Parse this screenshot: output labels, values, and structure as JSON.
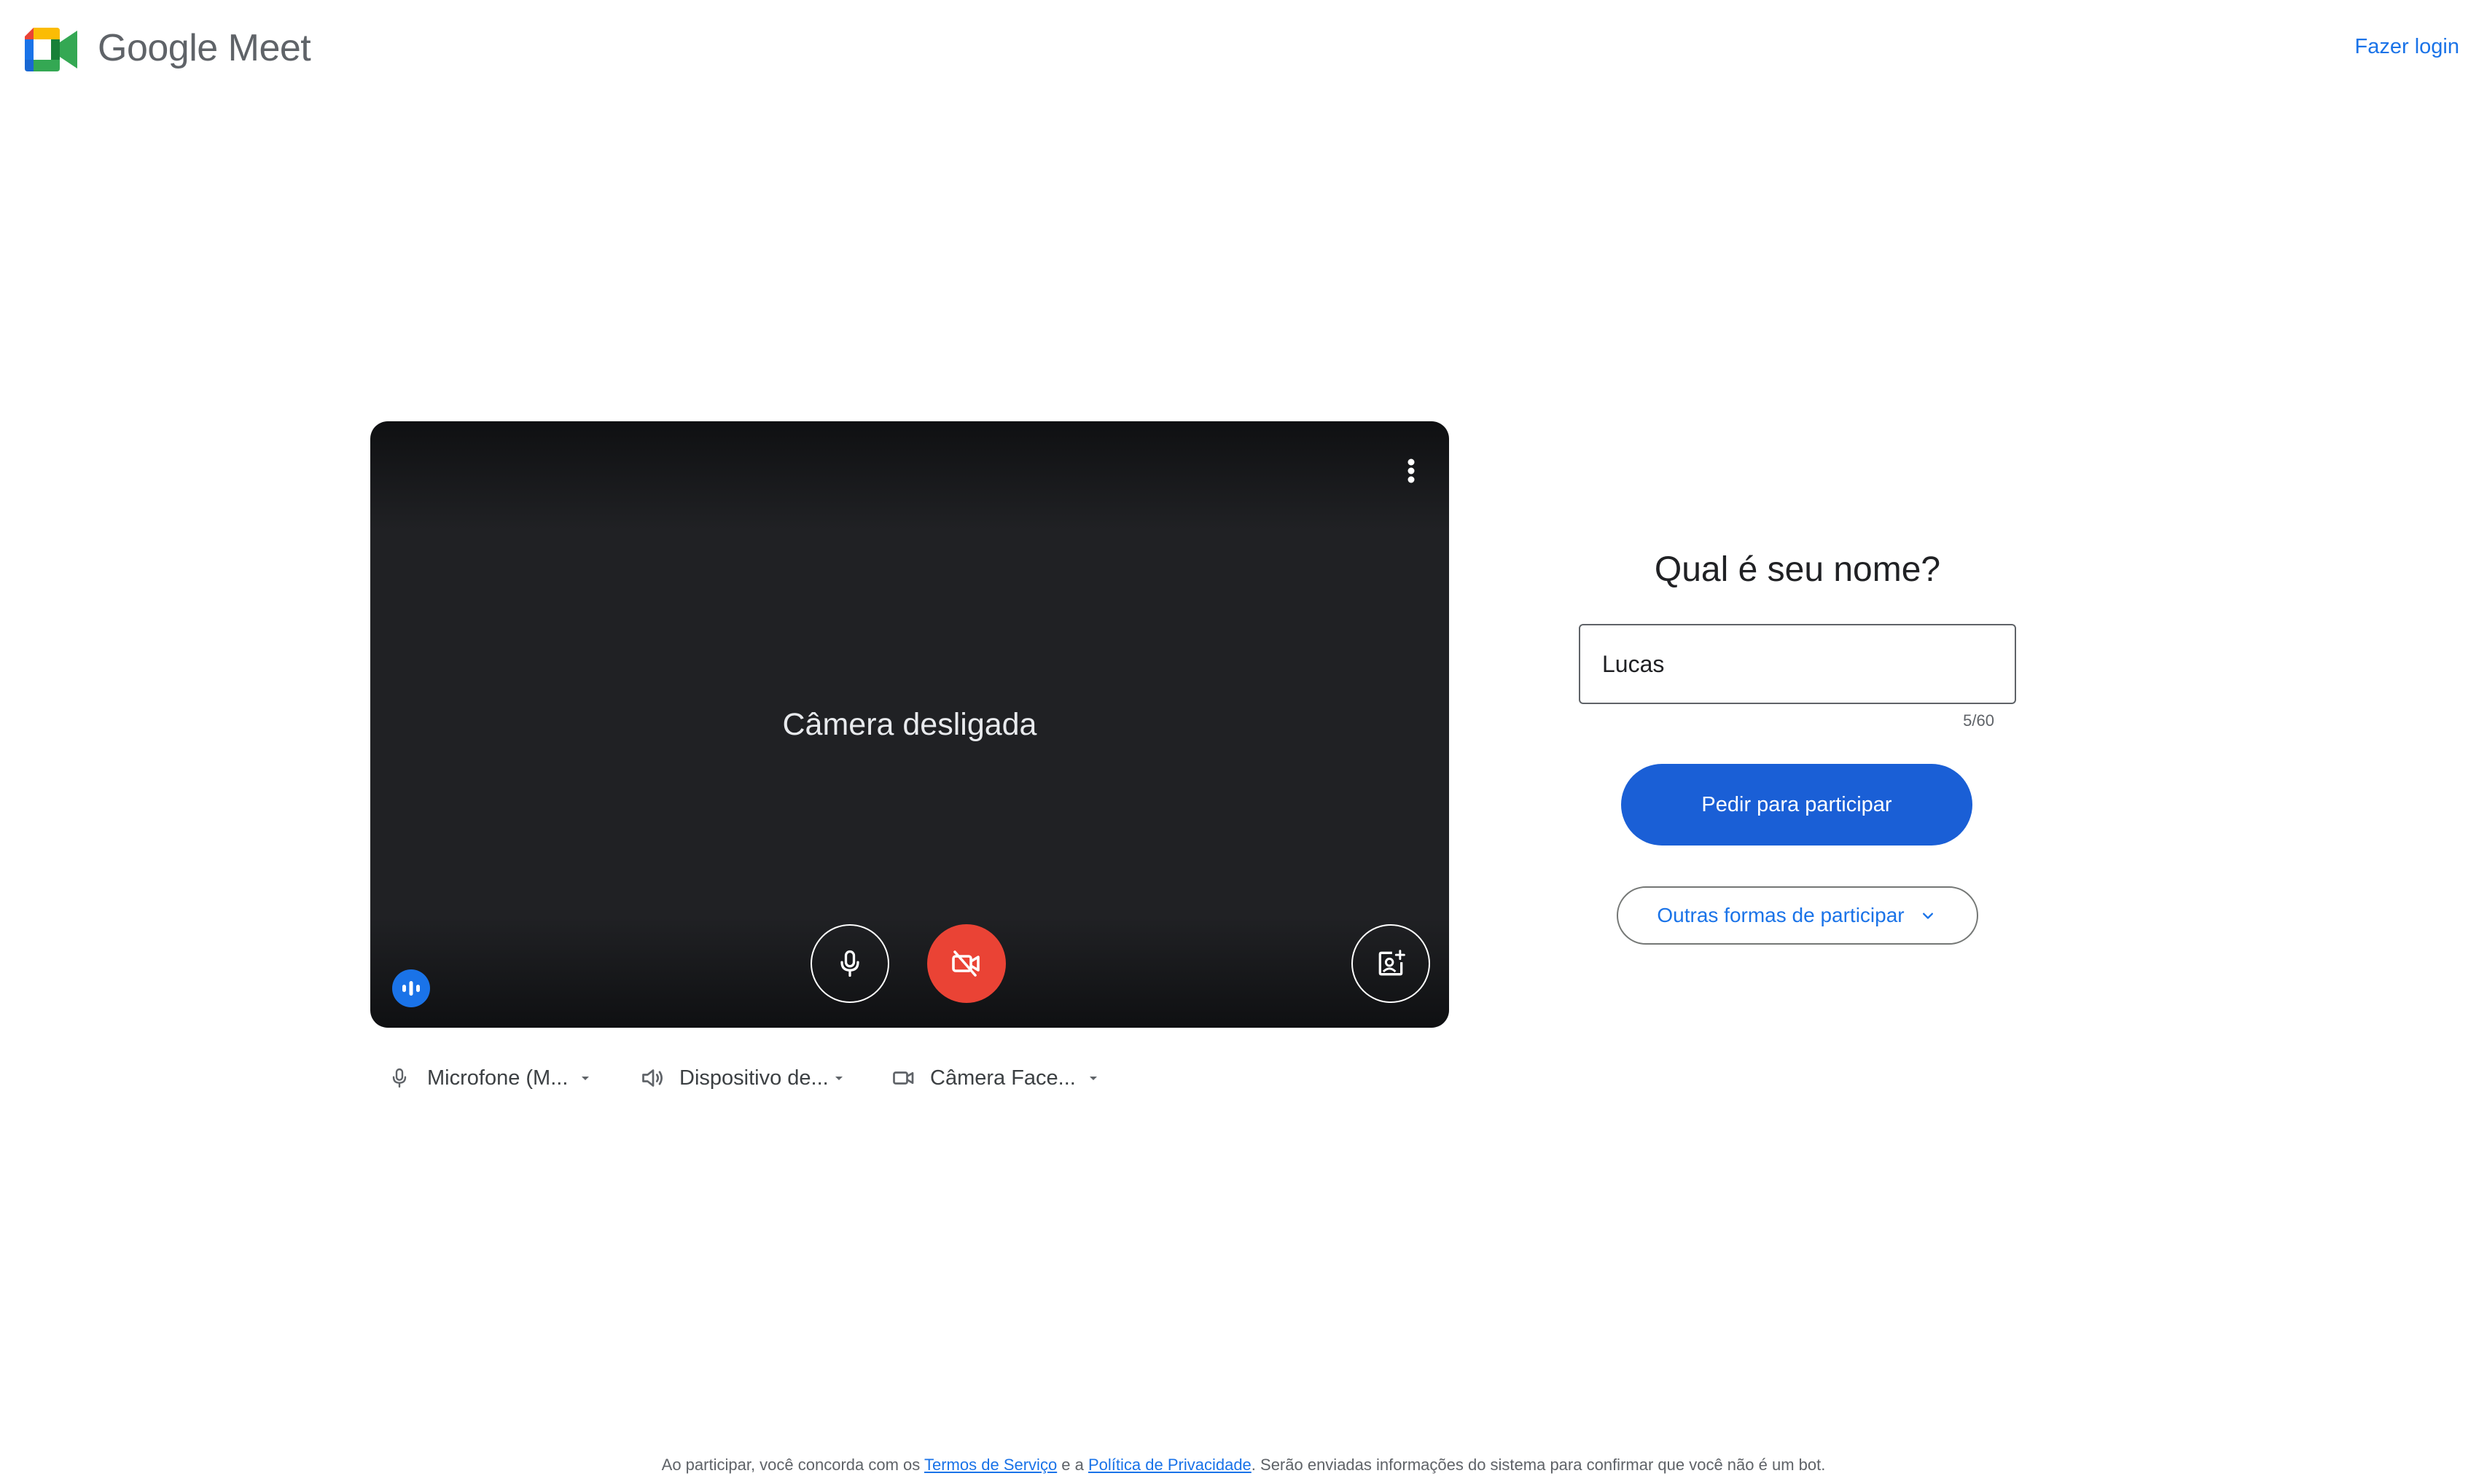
{
  "header": {
    "app_name": "Google Meet",
    "login_label": "Fazer login"
  },
  "preview": {
    "status_text": "Câmera desligada",
    "camera_off": true,
    "microphone_on": true
  },
  "devices": {
    "microphone_label": "Microfone (M...",
    "speaker_label": "Dispositivo de...",
    "camera_label": "Câmera Face..."
  },
  "join": {
    "title": "Qual é seu nome?",
    "name_value": "Lucas",
    "counter": "5/60",
    "ask_to_join_label": "Pedir para participar",
    "other_ways_label": "Outras formas de participar"
  },
  "footer": {
    "prefix": "Ao participar, você concorda com os ",
    "terms_link": "Termos de Serviço",
    "middle": " e a ",
    "privacy_link": "Política de Privacidade",
    "suffix": ". Serão enviadas informações do sistema para confirmar que você não é um bot."
  },
  "colors": {
    "accent_blue": "#1a73e8",
    "primary_button": "#1a5fd6",
    "camera_off_red": "#ea4335",
    "preview_background": "#202124"
  },
  "icons": [
    "google-meet-logo",
    "more-vert-icon",
    "mic-icon",
    "videocam-off-icon",
    "background-effects-icon",
    "audio-level-icon",
    "speaker-icon",
    "videocam-icon",
    "chevron-down-icon"
  ]
}
